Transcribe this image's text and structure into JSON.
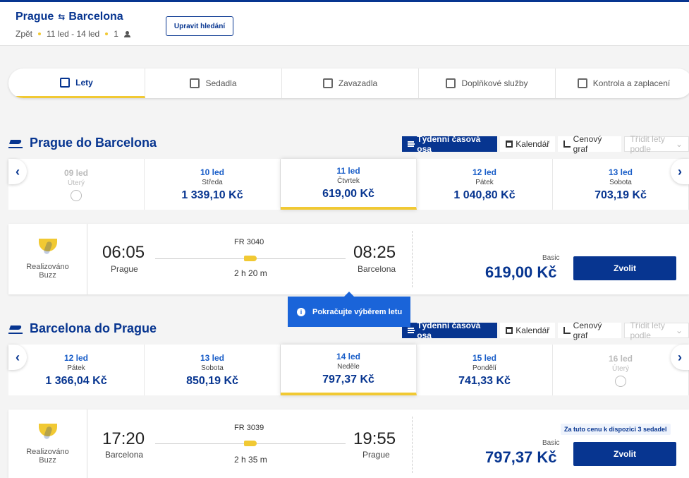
{
  "header": {
    "origin": "Prague",
    "destination": "Barcelona",
    "trip_type": "Zpět",
    "dates": "11 led - 14 led",
    "passengers": "1",
    "edit_label": "Upravit hledání"
  },
  "stepper": [
    {
      "label": "Lety",
      "icon": "plane-icon",
      "active": true
    },
    {
      "label": "Sedadla",
      "icon": "seat-icon",
      "active": false
    },
    {
      "label": "Zavazadla",
      "icon": "luggage-icon",
      "active": false
    },
    {
      "label": "Doplňkové služby",
      "icon": "bus-icon",
      "active": false
    },
    {
      "label": "Kontrola a zaplacení",
      "icon": "card-icon",
      "active": false
    }
  ],
  "view_tabs": {
    "weekly": "Týdenní časová osa",
    "calendar": "Kalendář",
    "price_graph": "Cenový graf",
    "sort_placeholder": "Třídit lety podle"
  },
  "outbound": {
    "title": "Prague do Barcelona",
    "dates": [
      {
        "date": "09 led",
        "weekday": "Úterý",
        "price": "",
        "available": false
      },
      {
        "date": "10 led",
        "weekday": "Středa",
        "price": "1 339,10 Kč",
        "available": true
      },
      {
        "date": "11 led",
        "weekday": "Čtvrtek",
        "price": "619,00 Kč",
        "available": true,
        "selected": true
      },
      {
        "date": "12 led",
        "weekday": "Pátek",
        "price": "1 040,80 Kč",
        "available": true
      },
      {
        "date": "13 led",
        "weekday": "Sobota",
        "price": "703,19 Kč",
        "available": true
      }
    ],
    "flight": {
      "operator": "Realizováno Buzz",
      "depart_time": "06:05",
      "depart_city": "Prague",
      "flight_number": "FR 3040",
      "duration": "2 h 20 m",
      "arrive_time": "08:25",
      "arrive_city": "Barcelona",
      "fare": "Basic",
      "price": "619,00 Kč",
      "select_label": "Zvolit"
    }
  },
  "tooltip": "Pokračujte výběrem letu",
  "inbound": {
    "title": "Barcelona do Prague",
    "dates": [
      {
        "date": "12 led",
        "weekday": "Pátek",
        "price": "1 366,04 Kč",
        "available": true
      },
      {
        "date": "13 led",
        "weekday": "Sobota",
        "price": "850,19 Kč",
        "available": true
      },
      {
        "date": "14 led",
        "weekday": "Neděle",
        "price": "797,37 Kč",
        "available": true,
        "selected": true
      },
      {
        "date": "15 led",
        "weekday": "Pondělí",
        "price": "741,33 Kč",
        "available": true
      },
      {
        "date": "16 led",
        "weekday": "Úterý",
        "price": "",
        "available": false
      }
    ],
    "flight": {
      "operator": "Realizováno Buzz",
      "depart_time": "17:20",
      "depart_city": "Barcelona",
      "flight_number": "FR 3039",
      "duration": "2 h 35 m",
      "arrive_time": "19:55",
      "arrive_city": "Prague",
      "fare": "Basic",
      "price": "797,37 Kč",
      "seats_note": "Za tuto cenu k dispozici 3 sedadel",
      "select_label": "Zvolit"
    }
  },
  "colors": {
    "brand": "#073590",
    "accent": "#f1c933",
    "info": "#1a64d9"
  }
}
